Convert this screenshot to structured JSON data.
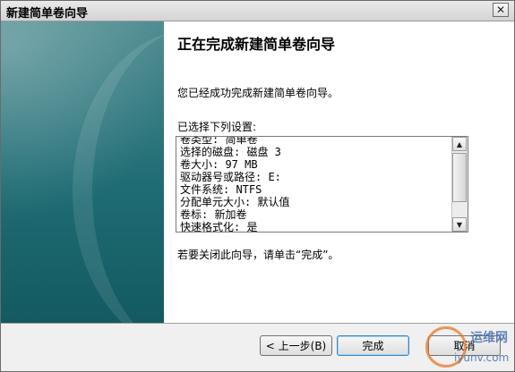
{
  "window": {
    "title": "新建简单卷向导",
    "close_glyph": "✕"
  },
  "content": {
    "heading": "正在完成新建简单卷向导",
    "success_text": "您已经成功完成新建简单卷向导。",
    "settings_label": "已选择下列设置:",
    "settings_lines": [
      "卷类型: 简单卷",
      "选择的磁盘: 磁盘 3",
      "卷大小: 97 MB",
      "驱动器号或路径: E:",
      "文件系统: NTFS",
      "分配单元大小: 默认值",
      "卷标: 新加卷",
      "快速格式化: 是"
    ],
    "finish_text": "若要关闭此向导，请单击“完成”。"
  },
  "scrollbar": {
    "up_arrow": "▲",
    "down_arrow": "▼"
  },
  "footer": {
    "back_label": "< 上一步(B)",
    "finish_label": "完成",
    "cancel_label": "取消"
  },
  "watermark": {
    "cn": "运维网",
    "en": "iyunv.com"
  }
}
